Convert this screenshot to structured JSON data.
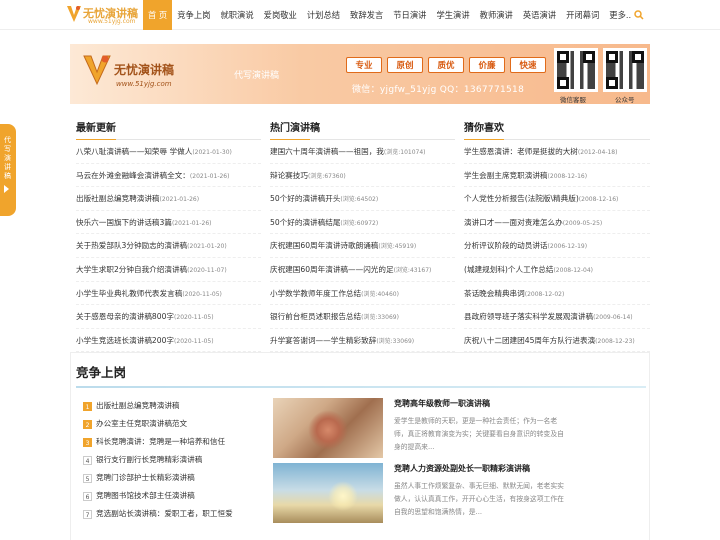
{
  "header": {
    "logo_cn": "无忧演讲稿",
    "logo_en": "www.51yjg.com",
    "nav": [
      "首 页",
      "竞争上岗",
      "就职演说",
      "爱岗敬业",
      "计划总结",
      "致辞发言",
      "节日演讲",
      "学生演讲",
      "教师演讲",
      "英语演讲",
      "开闭幕词",
      "更多.."
    ]
  },
  "banner": {
    "name": "无忧演讲稿",
    "url": "www.51yjg.com",
    "slogan": "代写演讲稿",
    "tags": [
      "专业",
      "原创",
      "质优",
      "价廉",
      "快速"
    ],
    "contact": "微信：yjgfw_51yjg    QQ：1367771518",
    "qr_labels": [
      "微信客服",
      "公众号"
    ]
  },
  "sidetab": {
    "label": "代写演讲稿"
  },
  "latest": {
    "title": "最新更新",
    "items": [
      {
        "t": "八荣八耻演讲稿——知荣辱 学做人",
        "d": "(2021-01-30)"
      },
      {
        "t": "马云在外滩金融峰会演讲稿全文：",
        "d": "(2021-01-26)"
      },
      {
        "t": "出版社副总编竞聘演讲稿",
        "d": "(2021-01-26)"
      },
      {
        "t": "快乐六一国旗下的讲话稿3篇",
        "d": "(2021-01-26)"
      },
      {
        "t": "关于热爱部队3分钟励志的演讲稿",
        "d": "(2021-01-20)"
      },
      {
        "t": "大学生求职2分钟自我介绍演讲稿",
        "d": "(2020-11-07)"
      },
      {
        "t": "小学生毕业典礼教师代表发言稿",
        "d": "(2020-11-05)"
      },
      {
        "t": "关于感恩母亲的演讲稿800字",
        "d": "(2020-11-05)"
      },
      {
        "t": "小学生竞选班长演讲稿200字",
        "d": "(2020-11-05)"
      }
    ]
  },
  "hot": {
    "title": "热门演讲稿",
    "items": [
      {
        "t": "建国六十周年演讲稿——祖国，我",
        "d": "(浏览:101074)"
      },
      {
        "t": "辩论赛技巧",
        "d": "(浏览:67360)"
      },
      {
        "t": "50个好的演讲稿开头",
        "d": "(浏览:64502)"
      },
      {
        "t": "50个好的演讲稿结尾",
        "d": "(浏览:60972)"
      },
      {
        "t": "庆祝建国60周年演讲诗歌朗诵稿",
        "d": "(浏览:45919)"
      },
      {
        "t": "庆祝建国60周年演讲稿——闪光的足",
        "d": "(浏览:43167)"
      },
      {
        "t": "小学数学教师年度工作总结",
        "d": "(浏览:40460)"
      },
      {
        "t": "银行前台柜员述职报告总结",
        "d": "(浏览:33069)"
      },
      {
        "t": "升学宴答谢词——学生精彩致辞",
        "d": "(浏览:33069)"
      }
    ]
  },
  "guess": {
    "title": "猜你喜欢",
    "items": [
      {
        "t": "学生感恩演讲：老师是挺拔的大树",
        "d": "(2012-04-18)"
      },
      {
        "t": "学生会副主席竞职演讲稿",
        "d": "(2008-12-16)"
      },
      {
        "t": "个人党性分析报告(法院版\\精典版)",
        "d": "(2008-12-16)"
      },
      {
        "t": "演讲口才——面对责难怎么办",
        "d": "(2009-05-25)"
      },
      {
        "t": "分析评议阶段的动员讲话",
        "d": "(2006-12-19)"
      },
      {
        "t": "(城建规划科)个人工作总结",
        "d": "(2008-12-04)"
      },
      {
        "t": "茶话晚会精典串词",
        "d": "(2008-12-02)"
      },
      {
        "t": "县政府领导班子落实科学发展观演讲稿",
        "d": "(2009-06-14)"
      },
      {
        "t": "庆祝八十二团建团45周年方队行进表演",
        "d": "(2008-12-23)"
      }
    ]
  },
  "section": {
    "title": "竞争上岗",
    "rank": [
      {
        "n": "1",
        "t": "出版社副总编竞聘演讲稿"
      },
      {
        "n": "2",
        "t": "办公室主任竞职演讲稿范文"
      },
      {
        "n": "3",
        "t": "科长竞聘演讲：竞聘是一种培养和信任"
      },
      {
        "n": "4",
        "t": "银行支行副行长竞聘精彩演讲稿"
      },
      {
        "n": "5",
        "t": "竞聘门诊部护士长精彩演讲稿"
      },
      {
        "n": "6",
        "t": "竞聘图书馆技术部主任演讲稿"
      },
      {
        "n": "7",
        "t": "竞选副站长演讲稿：爱职工者，职工恒爱"
      }
    ],
    "articles": [
      {
        "title": "竞聘高年级教师一职演讲稿",
        "summary": "爱学生是教师的天职，更是一种社会责任；作为一名老师，真正将教育演变为实；关键要看自身意识的转变及自身的提高来..."
      },
      {
        "title": "竞聘人力资源处副处长一职精彩演讲稿",
        "summary": "虽然人事工作烦繁复杂、事无巨细、默默无闻，老老实实做人，认认真真工作，开开心心生活，有按身这项工作在自我的思望和饱满热情，是..."
      }
    ]
  },
  "colors": {
    "accent": "#f0a42c"
  }
}
